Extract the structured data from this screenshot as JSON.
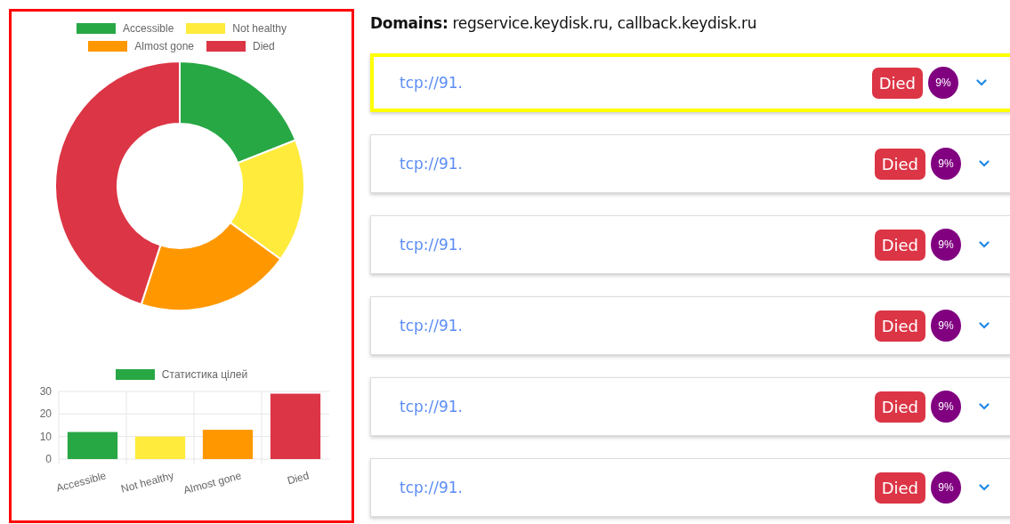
{
  "stats_panel": {
    "donut": {
      "chart_data": {
        "type": "donut",
        "categories": [
          "Accessible",
          "Not healthy",
          "Almost gone",
          "Died"
        ],
        "values": [
          19,
          16,
          20,
          45
        ],
        "colors": [
          "#28a745",
          "#ffeb3b",
          "#ff9800",
          "#dc3545"
        ]
      }
    },
    "bar": {
      "chart_data": {
        "type": "bar",
        "categories": [
          "Accessible",
          "Not healthy",
          "Almost gone",
          "Died"
        ],
        "series": [
          {
            "name": "Статистика цілей",
            "values": [
              12,
              10,
              13,
              29
            ]
          }
        ],
        "colors": [
          "#28a745",
          "#ffeb3b",
          "#ff9800",
          "#dc3545"
        ],
        "ylim": [
          0,
          30
        ],
        "yticks": [
          0,
          10,
          20,
          30
        ]
      }
    }
  },
  "domains": {
    "label": "Domains:",
    "value": "regservice.keydisk.ru, callback.keydisk.ru"
  },
  "targets": [
    {
      "url": "tcp://91.",
      "status": "Died",
      "color": "#dc3545",
      "percent": "9%",
      "selected": true
    },
    {
      "url": "tcp://91.",
      "status": "Died",
      "color": "#dc3545",
      "percent": "9%",
      "selected": false
    },
    {
      "url": "tcp://91.",
      "status": "Died",
      "color": "#dc3545",
      "percent": "9%",
      "selected": false
    },
    {
      "url": "tcp://91.",
      "status": "Died",
      "color": "#dc3545",
      "percent": "9%",
      "selected": false
    },
    {
      "url": "tcp://91.",
      "status": "Died",
      "color": "#dc3545",
      "percent": "9%",
      "selected": false
    },
    {
      "url": "tcp://91.",
      "status": "Died",
      "color": "#dc3545",
      "percent": "9%",
      "selected": false
    }
  ]
}
